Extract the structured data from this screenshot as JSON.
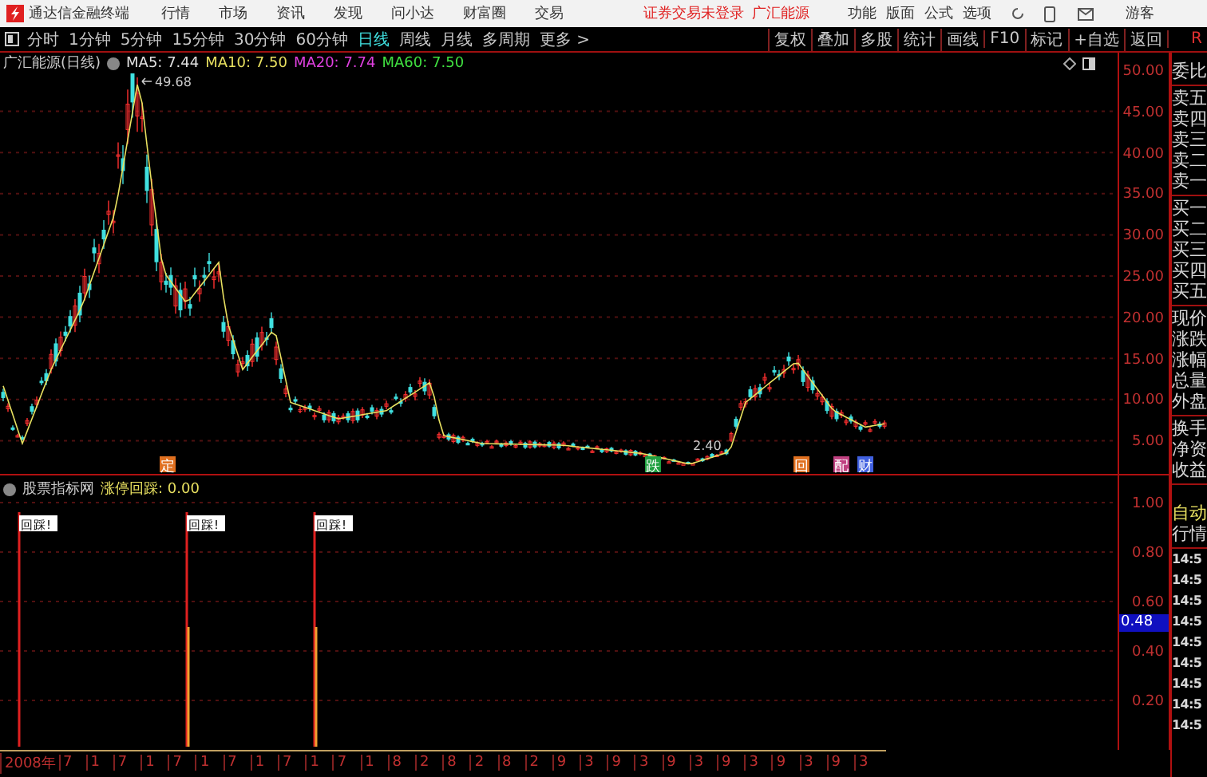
{
  "app_bar": {
    "title": "通达信金融终端",
    "menu": [
      "行情",
      "市场",
      "资讯",
      "发现",
      "问小达",
      "财富圈",
      "交易"
    ],
    "login_status": "证券交易未登录",
    "stock": "广汇能源",
    "tools": [
      "功能",
      "版面",
      "公式",
      "选项"
    ],
    "user": "游客"
  },
  "toolbar": {
    "periods": [
      {
        "label": "分时",
        "selected": false
      },
      {
        "label": "1分钟",
        "selected": false
      },
      {
        "label": "5分钟",
        "selected": false
      },
      {
        "label": "15分钟",
        "selected": false
      },
      {
        "label": "30分钟",
        "selected": false
      },
      {
        "label": "60分钟",
        "selected": false
      },
      {
        "label": "日线",
        "selected": true
      },
      {
        "label": "周线",
        "selected": false
      },
      {
        "label": "月线",
        "selected": false
      },
      {
        "label": "多周期",
        "selected": false
      },
      {
        "label": "更多 >",
        "selected": false
      }
    ],
    "actions": [
      "复权",
      "叠加",
      "多股",
      "统计",
      "画线",
      "F10",
      "标记",
      "+自选",
      "返回"
    ],
    "corner": "R"
  },
  "chart": {
    "title": "广汇能源(日线)",
    "ma": [
      {
        "label": "MA5: 7.44",
        "color": "#e0e0e0"
      },
      {
        "label": "MA10: 7.50",
        "color": "#e8e060"
      },
      {
        "label": "MA20: 7.74",
        "color": "#e040e0"
      },
      {
        "label": "MA60: 7.50",
        "color": "#40e040"
      }
    ],
    "high_label": "49.68",
    "low_label": "2.40",
    "price_ticks": [
      "50.00",
      "45.00",
      "40.00",
      "35.00",
      "30.00",
      "25.00",
      "20.00",
      "15.00",
      "10.00",
      "5.00"
    ],
    "events": [
      {
        "label": "定",
        "color": "#e07020"
      },
      {
        "label": "跌",
        "color": "#20a040"
      },
      {
        "label": "回",
        "color": "#e07020"
      },
      {
        "label": "配",
        "color": "#c04080"
      },
      {
        "label": "财",
        "color": "#4060e0"
      }
    ]
  },
  "indicator": {
    "source": "股票指标网",
    "name": "涨停回踩: 0.00",
    "signals": [
      "回踩!",
      "回踩!",
      "回踩!"
    ],
    "ticks": [
      "1.00",
      "0.80",
      "0.60",
      "0.40",
      "0.20"
    ],
    "current": "0.48"
  },
  "date_axis": [
    "2008年",
    "7",
    "1",
    "7",
    "1",
    "7",
    "1",
    "7",
    "1",
    "7",
    "1",
    "7",
    "1",
    "8",
    "2",
    "8",
    "2",
    "8",
    "2",
    "9",
    "3",
    "9",
    "3",
    "9",
    "3",
    "9",
    "3",
    "9",
    "3",
    "9",
    "3"
  ],
  "quote_panel": {
    "groups": [
      [
        "委比"
      ],
      [
        "卖五",
        "卖四",
        "卖三",
        "卖二",
        "卖一"
      ],
      [
        "买一",
        "买二",
        "买三",
        "买四",
        "买五"
      ],
      [
        "现价",
        "涨跌",
        "涨幅",
        "总量",
        "外盘"
      ],
      [
        "换手",
        "净资",
        "收益"
      ]
    ],
    "mode": "自动",
    "section": "行情",
    "times": [
      "14:5",
      "14:5",
      "14:5",
      "14:5",
      "14:5",
      "14:5",
      "14:5",
      "14:5",
      "14:5"
    ]
  }
}
